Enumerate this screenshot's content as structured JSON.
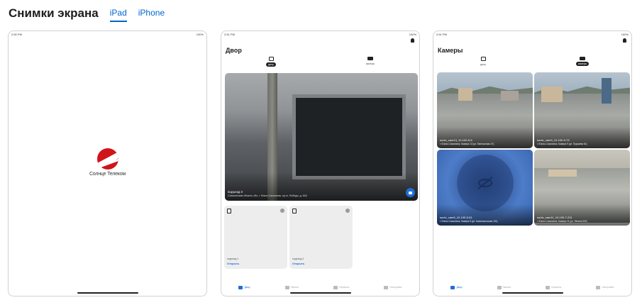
{
  "header": {
    "title": "Снимки экрана",
    "tabs": [
      {
        "label": "iPad",
        "active": true
      },
      {
        "label": "iPhone",
        "active": false
      }
    ]
  },
  "colors": {
    "accent": "#0066cc",
    "brand_red": "#d1141a",
    "app_blue": "#1f6fd6"
  },
  "screenshots": [
    {
      "status": {
        "time": "2:50 PM",
        "right": "100%"
      },
      "logo_text": "Солнце Телеком"
    },
    {
      "status": {
        "time": "2:51 PM",
        "right": "100%"
      },
      "title": "Двор",
      "segments": [
        {
          "label": "двор",
          "active": true,
          "icon": "door-icon"
        },
        {
          "label": "камеры",
          "active": false,
          "icon": "camera-icon"
        }
      ],
      "camera": {
        "name": "подъезд 3",
        "address": "Сахалинская область обл, г. Южно-Сахалинск, пр-кт. Победы, д. 46А"
      },
      "doors": [
        {
          "name": "подъезд 1",
          "action": "Открыть"
        },
        {
          "name": "подъезд 2",
          "action": "Открыть"
        }
      ],
      "tabbar": [
        {
          "label": "Двор",
          "active": true
        },
        {
          "label": "Звонки",
          "active": false
        },
        {
          "label": "Сервисы",
          "active": false
        },
        {
          "label": "Настройки",
          "active": false
        }
      ]
    },
    {
      "status": {
        "time": "2:51 PM",
        "right": "100%"
      },
      "title": "Камеры",
      "segments": [
        {
          "label": "двор",
          "active": false,
          "icon": "door-icon"
        },
        {
          "label": "камеры",
          "active": true,
          "icon": "camera-icon"
        }
      ],
      "cameras": [
        {
          "name": "suntv_cam13_10-100-5-8",
          "address": "г. Южно-Сахалинск, Камера 13 (ул. Емельянова 37)",
          "offline": false
        },
        {
          "name": "suntv_cam9_10-100-5-73",
          "address": "г. Южно-Сахалинск, Камера 9 (ул. Пуркаева 81)",
          "offline": false
        },
        {
          "name": "suntv_cam5_10-100-5-51",
          "address": "г. Южно-Сахалинск, Камера 5 (ул. Комсомольская 151)",
          "offline": true
        },
        {
          "name": "suntv_cam11_10-100-7-211",
          "address": "г. Южно-Сахалинск, Камера 11 (ул. Ленина 332)",
          "offline": false
        }
      ],
      "tabbar": [
        {
          "label": "Двор",
          "active": true
        },
        {
          "label": "Звонки",
          "active": false
        },
        {
          "label": "Сервисы",
          "active": false
        },
        {
          "label": "Настройки",
          "active": false
        }
      ]
    }
  ]
}
